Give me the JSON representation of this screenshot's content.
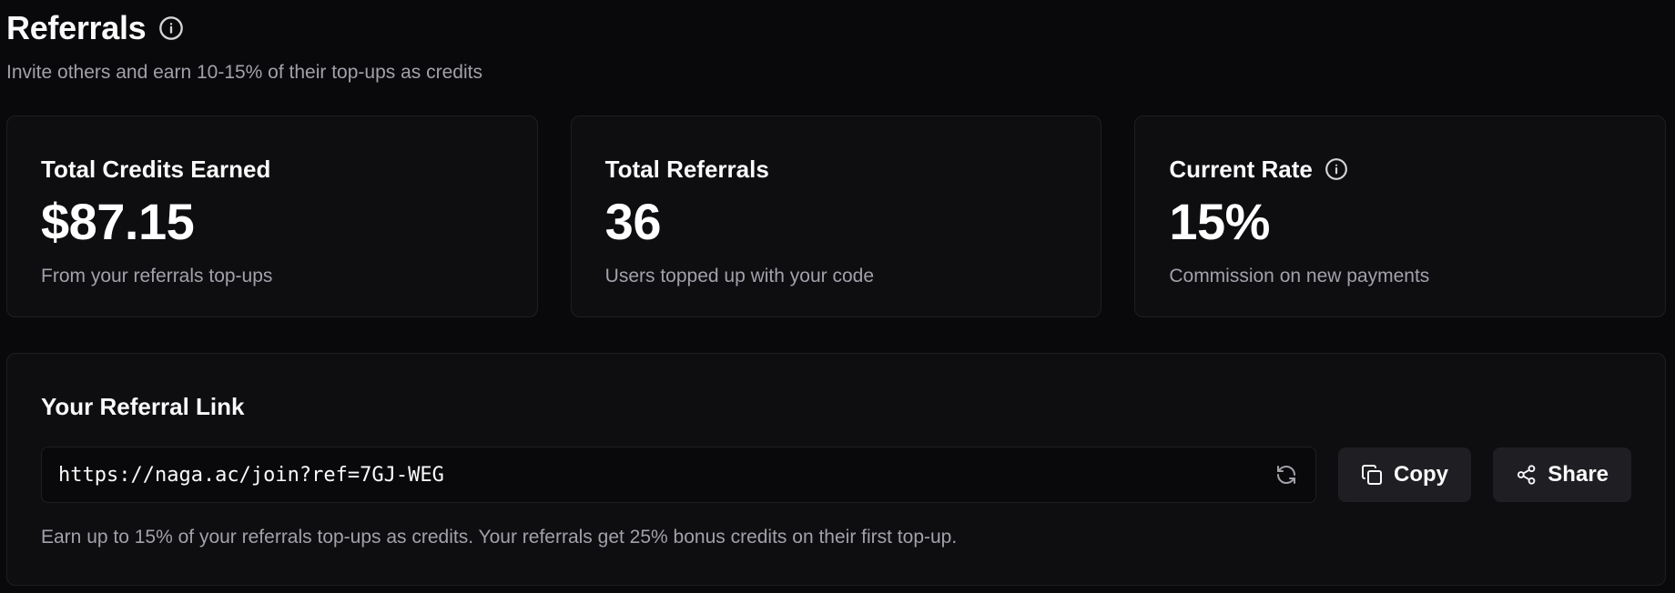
{
  "header": {
    "title": "Referrals",
    "subtitle": "Invite others and earn 10-15% of their top-ups as credits",
    "info_icon": "info-circle-icon"
  },
  "stats": [
    {
      "label": "Total Credits Earned",
      "value": "$87.15",
      "description": "From your referrals top-ups"
    },
    {
      "label": "Total Referrals",
      "value": "36",
      "description": "Users topped up with your code"
    },
    {
      "label": "Current Rate",
      "value": "15%",
      "description": "Commission on new payments",
      "info_icon": "info-circle-icon"
    }
  ],
  "referral_link": {
    "title": "Your Referral Link",
    "url": "https://naga.ac/join?ref=7GJ-WEG",
    "refresh_icon": "refresh-icon",
    "copy_label": "Copy",
    "copy_icon": "copy-icon",
    "share_label": "Share",
    "share_icon": "share-icon",
    "note": "Earn up to 15% of your referrals top-ups as credits. Your referrals get 25% bonus credits on their first top-up."
  },
  "colors": {
    "background": "#09090b",
    "card": "#0e0e11",
    "border": "#1f1f23",
    "text": "#fafafa",
    "muted": "#a1a1aa",
    "button": "#1f1f23"
  }
}
